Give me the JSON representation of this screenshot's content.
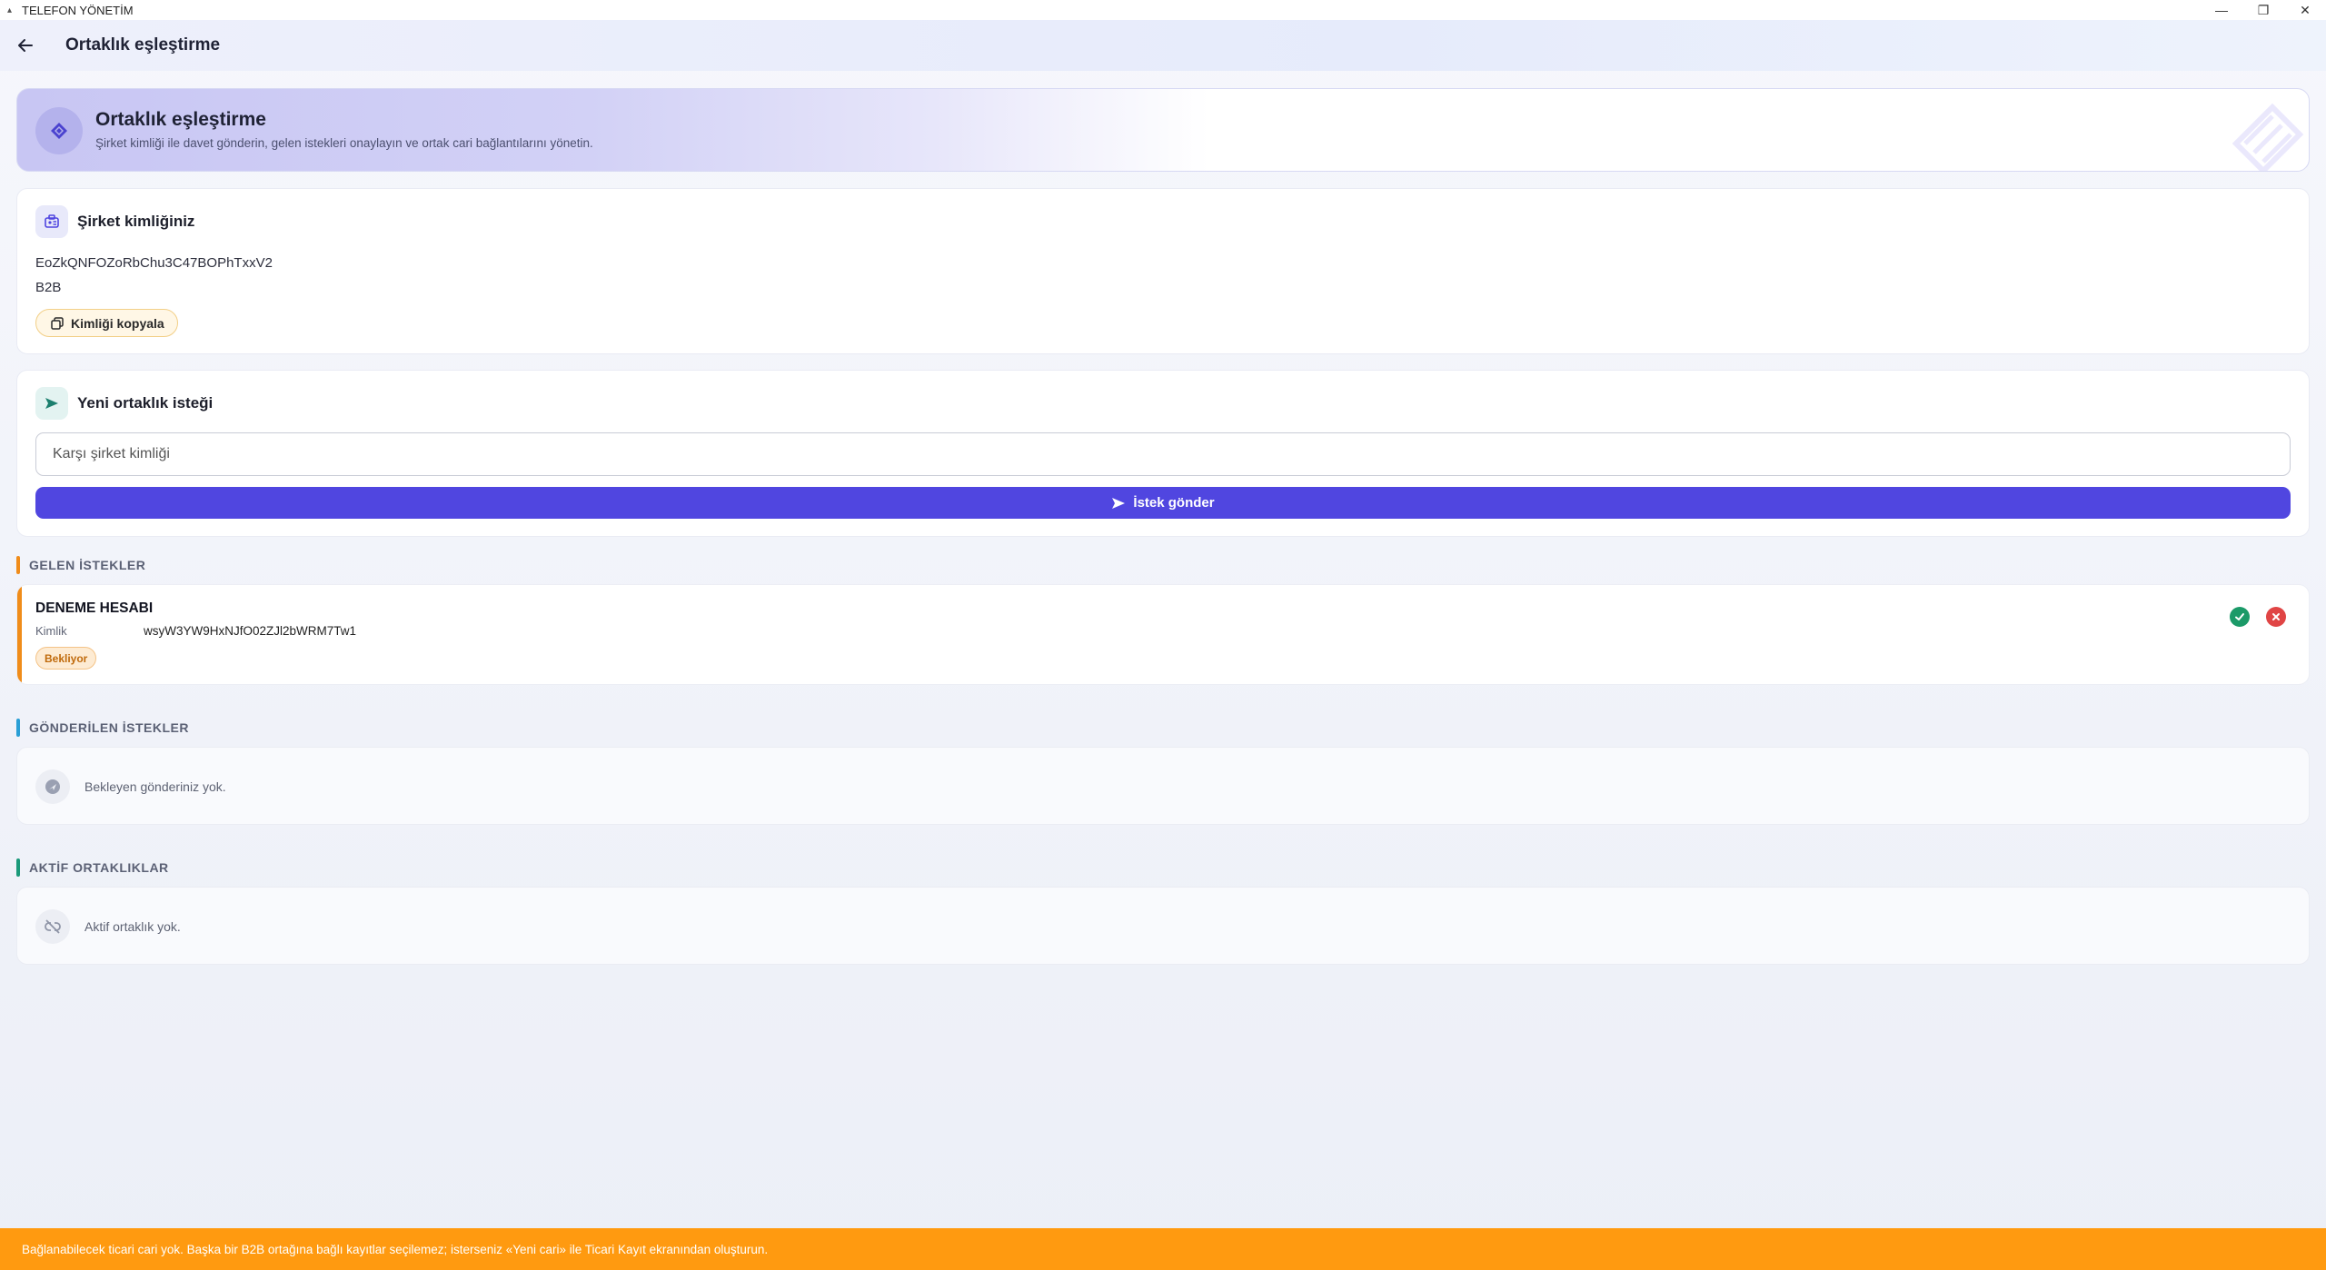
{
  "window": {
    "title": "TELEFON YÖNETİM"
  },
  "header": {
    "title": "Ortaklık eşleştirme"
  },
  "hero": {
    "title": "Ortaklık eşleştirme",
    "subtitle": "Şirket kimliği ile davet gönderin, gelen istekleri onaylayın ve ortak cari bağlantılarını yönetin."
  },
  "company": {
    "title": "Şirket kimliğiniz",
    "id": "EoZkQNFOZoRbChu3C47BOPhTxxV2",
    "type": "B2B",
    "copy_label": "Kimliği kopyala"
  },
  "new_request": {
    "title": "Yeni ortaklık isteği",
    "placeholder": "Karşı şirket kimliği",
    "send_label": "İstek gönder"
  },
  "incoming": {
    "section_title": "GELEN İSTEKLER",
    "items": [
      {
        "name": "DENEME HESABI",
        "id_label": "Kimlik",
        "id": "wsyW3YW9HxNJfO02ZJl2bWRM7Tw1",
        "status": "Bekliyor"
      }
    ]
  },
  "sent": {
    "section_title": "GÖNDERİLEN İSTEKLER",
    "empty_text": "Bekleyen gönderiniz yok."
  },
  "active": {
    "section_title": "AKTİF ORTAKLIKLAR",
    "empty_text": "Aktif ortaklık yok."
  },
  "banner": {
    "text": "Bağlanabilecek ticari cari yok. Başka bir B2B ortağına bağlı kayıtlar seçilemez; isterseniz «Yeni cari» ile Ticari Kayıt ekranından oluşturun."
  },
  "colors": {
    "accent": "#5046e0",
    "warning": "#ff9a10",
    "incoming_bar": "#f08c1a",
    "sent_bar": "#2a9fd6",
    "active_bar": "#1b9a7a",
    "approve": "#1b9a68",
    "reject": "#e04545"
  }
}
